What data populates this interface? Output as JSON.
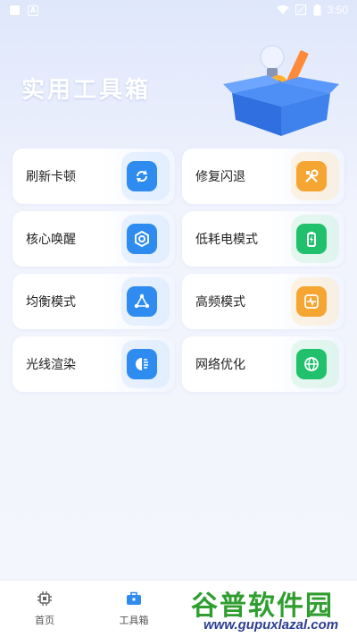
{
  "status_bar": {
    "time": "3:50"
  },
  "header": {
    "title": "实用工具箱"
  },
  "tools": [
    {
      "label": "刷新卡顿",
      "icon": "refresh-icon",
      "color": "#2e8bf0",
      "deco": "#cfe3ff"
    },
    {
      "label": "修复闪退",
      "icon": "tools-icon",
      "color": "#f5a531",
      "deco": "#ffe6c4"
    },
    {
      "label": "核心唤醒",
      "icon": "core-icon",
      "color": "#2e8bf0",
      "deco": "#cfe3ff"
    },
    {
      "label": "低耗电模式",
      "icon": "battery-icon",
      "color": "#21c06d",
      "deco": "#c9f2dc"
    },
    {
      "label": "均衡模式",
      "icon": "balance-icon",
      "color": "#2e8bf0",
      "deco": "#cfe3ff"
    },
    {
      "label": "高频模式",
      "icon": "pulse-icon",
      "color": "#f5a531",
      "deco": "#ffe6c4"
    },
    {
      "label": "光线渲染",
      "icon": "light-icon",
      "color": "#2e8bf0",
      "deco": "#cfe3ff"
    },
    {
      "label": "网络优化",
      "icon": "globe-icon",
      "color": "#21c06d",
      "deco": "#c9f2dc"
    }
  ],
  "bottom_nav": {
    "items": [
      {
        "label": "首页",
        "icon": "chip-icon"
      },
      {
        "label": "工具箱",
        "icon": "toolbox-icon"
      }
    ]
  },
  "watermark": {
    "title": "谷普软件园",
    "url": "www.gupuxlazal.com"
  }
}
